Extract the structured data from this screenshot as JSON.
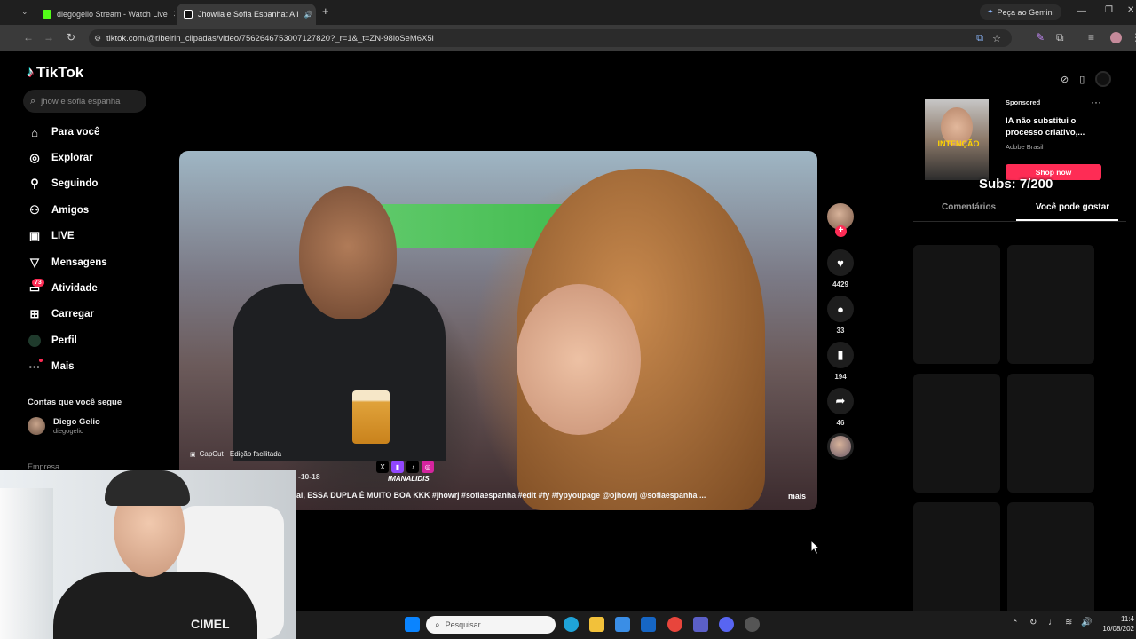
{
  "browser": {
    "tabs": [
      {
        "label": "diegogelio Stream - Watch Live",
        "favicon_color": "#53fc18"
      },
      {
        "label": "Jhowlia e Sofia Espanha: A I",
        "favicon_color": "#ffffff"
      }
    ],
    "new_tab": "+",
    "gemini_label": "Peça ao Gemini",
    "url": "tiktok.com/@ribeirin_clipadas/video/7562646753007127820?_r=1&_t=ZN-98loSeM6X5i"
  },
  "tiktok": {
    "logo": "TikTok",
    "search_placeholder": "jhow e sofia espanha",
    "nav": [
      {
        "label": "Para você",
        "icon": "home-icon"
      },
      {
        "label": "Explorar",
        "icon": "compass-icon"
      },
      {
        "label": "Seguindo",
        "icon": "following-icon"
      },
      {
        "label": "Amigos",
        "icon": "friends-icon"
      },
      {
        "label": "LIVE",
        "icon": "live-icon"
      },
      {
        "label": "Mensagens",
        "icon": "messages-icon"
      },
      {
        "label": "Atividade",
        "icon": "activity-icon"
      },
      {
        "label": "Carregar",
        "icon": "upload-icon"
      },
      {
        "label": "Perfil",
        "icon": "profile-icon"
      },
      {
        "label": "Mais",
        "icon": "more-icon"
      }
    ],
    "activity_badge": "73",
    "following_title": "Contas que você segue",
    "following": {
      "name": "Diego Gelio",
      "handle": "diegogelio"
    },
    "empresa": "Empresa"
  },
  "video": {
    "capcut": "CapCut · Edição facilitada",
    "date": "-10-18",
    "watermark": "IMANALIDIS",
    "caption": "al, ESSA DUPLA É MUITO BOA KKK #jhowrj #sofiaespanha #edit #fy #fypyoupage @ojhowrj @sofiaespanha ...",
    "more": "mais"
  },
  "actions": {
    "likes": "4429",
    "comments": "33",
    "saves": "194",
    "shares": "46"
  },
  "ad": {
    "thumb_text": "INTENÇÃO",
    "sponsored": "Sponsored",
    "title": "IA não substitui o processo criativo,...",
    "brand": "Adobe Brasil",
    "cta": "Shop now",
    "more": "···"
  },
  "overlay": {
    "subs": "Subs: 7/200"
  },
  "right_tabs": {
    "comments": "Comentários",
    "recommended": "Você pode gostar"
  },
  "webcam": {
    "shirt_text": "CIMEL"
  },
  "taskbar": {
    "search_placeholder": "Pesquisar",
    "time": "11:4",
    "date": "10/08/202"
  }
}
